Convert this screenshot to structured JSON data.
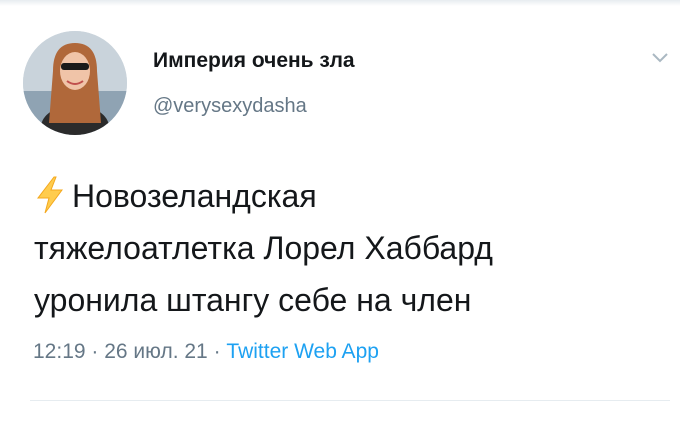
{
  "author": {
    "display_name": "Империя очень зла",
    "handle": "@verysexydasha"
  },
  "tweet": {
    "lines": [
      "Новозеландская",
      "тяжелоатлетка Лорел Хаббард",
      "уронила штангу себе на член"
    ],
    "emoji_icon": "lightning-bolt-icon"
  },
  "meta": {
    "time": "12:19",
    "sep1": " · ",
    "date": "26 июл. 21",
    "sep2": " · ",
    "source": "Twitter Web App"
  },
  "colors": {
    "text": "#14171a",
    "secondary": "#657786",
    "link": "#1da1f2",
    "bolt": "#ffcc4d"
  }
}
